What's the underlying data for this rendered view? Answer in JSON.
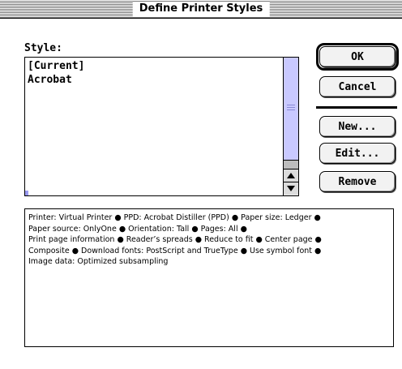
{
  "window": {
    "title": "Define Printer Styles"
  },
  "style_label": "Style:",
  "styles": [
    "[Current]",
    "Acrobat"
  ],
  "buttons": {
    "ok": "OK",
    "cancel": "Cancel",
    "new": "New...",
    "edit": "Edit...",
    "remove": "Remove"
  },
  "description_lines": [
    "Printer: Virtual Printer ● PPD: Acrobat Distiller (PPD) ● Paper size: Ledger ●",
    "Paper source: OnlyOne ● Orientation: Tall ● Pages: All ●",
    "Print page information ● Reader’s spreads ● Reduce to fit ● Center page ●",
    "Composite ● Download fonts: PostScript and TrueType ● Use symbol font ●",
    "Image data: Optimized subsampling"
  ],
  "colors": {
    "scroll_track": "#c9c9ff",
    "accent": "#9a9af0"
  }
}
